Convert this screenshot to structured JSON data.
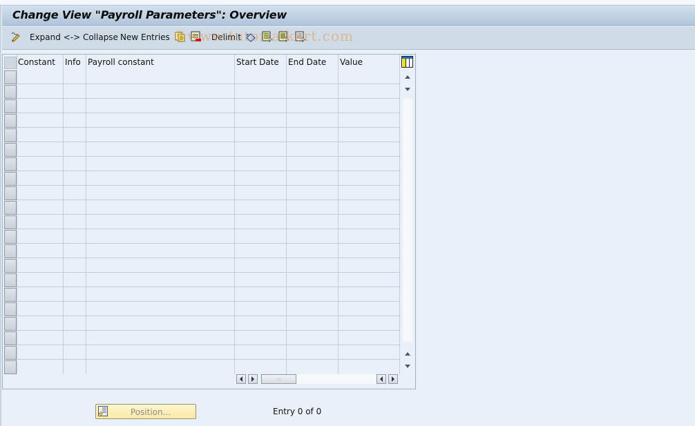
{
  "window": {
    "title": "Change View \"Payroll Parameters\": Overview"
  },
  "toolbar": {
    "items": [
      {
        "icon": "edit-pencil-icon"
      },
      {
        "label": "Expand <-> Collapse"
      },
      {
        "label": "New Entries"
      },
      {
        "icon": "copy-as-icon"
      },
      {
        "icon": "delete-icon"
      },
      {
        "label": "Delimit"
      },
      {
        "icon": "undo-change-icon"
      },
      {
        "icon": "select-all-icon"
      },
      {
        "icon": "select-block-icon"
      },
      {
        "icon": "deselect-all-icon"
      }
    ],
    "expand_collapse_label": "Expand <-> Collapse",
    "new_entries_label": "New Entries",
    "delimit_label": "Delimit"
  },
  "watermark": "©www.tutorialkart.com",
  "table": {
    "columns": [
      "Constant",
      "Info",
      "Payroll constant",
      "Start Date",
      "End Date",
      "Value"
    ],
    "rows": [],
    "visible_empty_rows": 21,
    "column_settings_icon": "table-settings-icon"
  },
  "footer": {
    "position_button_label": "Position...",
    "entry_text": "Entry 0 of 0"
  }
}
